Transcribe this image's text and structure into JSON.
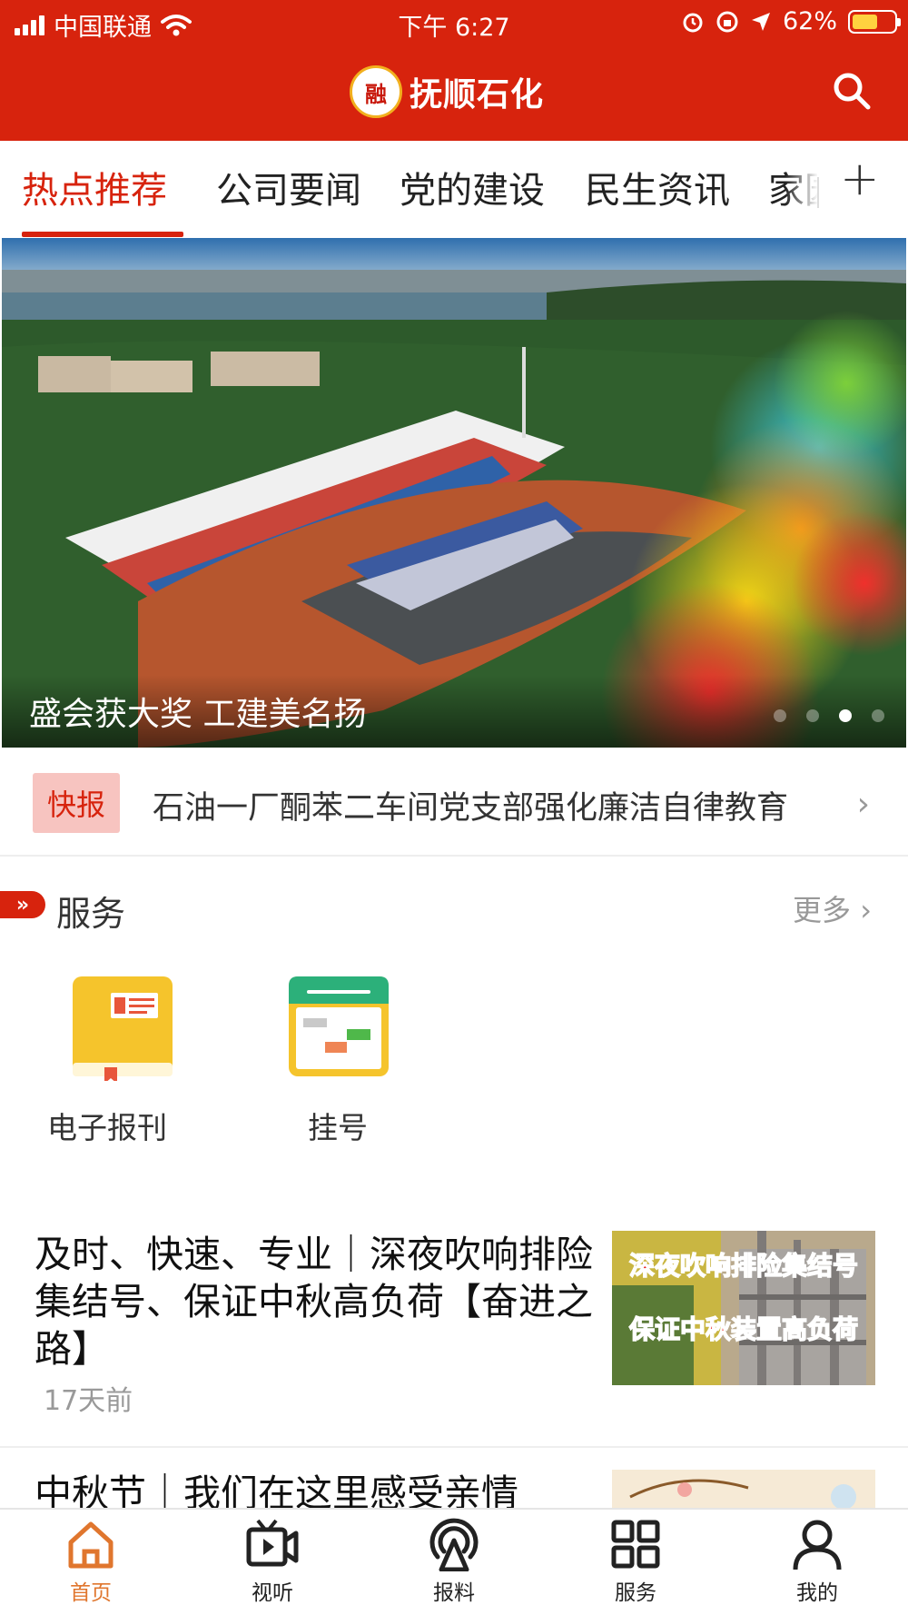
{
  "status_bar": {
    "carrier": "中国联通",
    "time": "下午 6:27",
    "battery": "62%"
  },
  "header": {
    "logo_text": "融",
    "title": "抚顺石化"
  },
  "tabs": [
    {
      "label": "热点推荐",
      "active": true
    },
    {
      "label": "公司要闻",
      "active": false
    },
    {
      "label": "党的建设",
      "active": false
    },
    {
      "label": "民生资讯",
      "active": false
    },
    {
      "label": "家园",
      "active": false
    }
  ],
  "tab_add": "+",
  "banner": {
    "caption": "盛会获大奖 工建美名扬",
    "slide_count": 4,
    "active_slide": 3
  },
  "flash": {
    "badge": "快报",
    "text": "石油一厂酮苯二车间党支部强化廉洁自律教育",
    "arrow": "›"
  },
  "services": {
    "title": "服务",
    "more": "更多 ›",
    "items": [
      {
        "label": "电子报刊",
        "icon": "e-newspaper-icon"
      },
      {
        "label": "挂号",
        "icon": "calendar-registration-icon"
      }
    ]
  },
  "news": [
    {
      "title": "及时、快速、专业｜深夜吹响排险集结号、保证中秋高负荷【奋进之路】",
      "time": "17天前",
      "thumb_lines": [
        "深夜吹响排险集结号",
        "保证中秋装置高负荷"
      ]
    },
    {
      "title": "中秋节｜我们在这里感受亲情",
      "time": ""
    }
  ],
  "bottom_nav": [
    {
      "label": "首页",
      "icon": "home-icon",
      "active": true
    },
    {
      "label": "视听",
      "icon": "video-icon",
      "active": false
    },
    {
      "label": "报料",
      "icon": "broadcast-icon",
      "active": false
    },
    {
      "label": "服务",
      "icon": "grid-icon",
      "active": false
    },
    {
      "label": "我的",
      "icon": "user-icon",
      "active": false
    }
  ],
  "colors": {
    "brand_red": "#d7230d",
    "nav_active": "#e0762e",
    "badge_bg": "#f7c4c0"
  }
}
